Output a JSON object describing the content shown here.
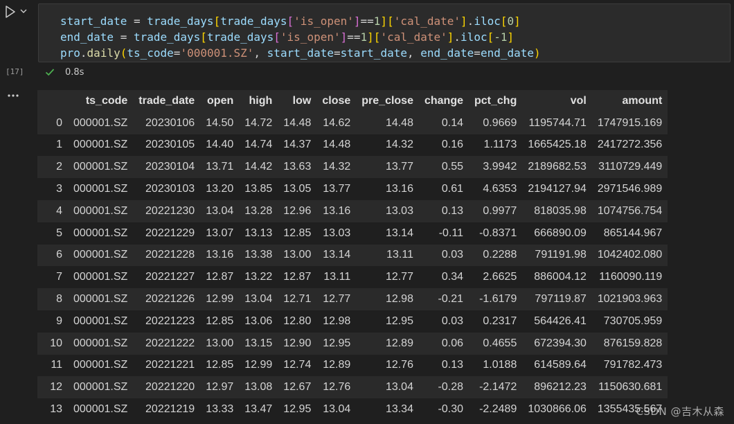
{
  "cell": {
    "execution_count": "[17]",
    "status_time": "0.8s",
    "code_lines": [
      [
        {
          "t": "start_date",
          "c": "v"
        },
        {
          "t": " = ",
          "c": "op"
        },
        {
          "t": "trade_days",
          "c": "v"
        },
        {
          "t": "[",
          "c": "b"
        },
        {
          "t": "trade_days",
          "c": "v"
        },
        {
          "t": "[",
          "c": "b2"
        },
        {
          "t": "'is_open'",
          "c": "s"
        },
        {
          "t": "]",
          "c": "b2"
        },
        {
          "t": "==",
          "c": "op"
        },
        {
          "t": "1",
          "c": "n"
        },
        {
          "t": "]",
          "c": "b"
        },
        {
          "t": "[",
          "c": "b"
        },
        {
          "t": "'cal_date'",
          "c": "s"
        },
        {
          "t": "]",
          "c": "b"
        },
        {
          "t": ".",
          "c": "op"
        },
        {
          "t": "iloc",
          "c": "v"
        },
        {
          "t": "[",
          "c": "b"
        },
        {
          "t": "0",
          "c": "n"
        },
        {
          "t": "]",
          "c": "b"
        }
      ],
      [
        {
          "t": "end_date",
          "c": "v"
        },
        {
          "t": " = ",
          "c": "op"
        },
        {
          "t": "trade_days",
          "c": "v"
        },
        {
          "t": "[",
          "c": "b"
        },
        {
          "t": "trade_days",
          "c": "v"
        },
        {
          "t": "[",
          "c": "b2"
        },
        {
          "t": "'is_open'",
          "c": "s"
        },
        {
          "t": "]",
          "c": "b2"
        },
        {
          "t": "==",
          "c": "op"
        },
        {
          "t": "1",
          "c": "n"
        },
        {
          "t": "]",
          "c": "b"
        },
        {
          "t": "[",
          "c": "b"
        },
        {
          "t": "'cal_date'",
          "c": "s"
        },
        {
          "t": "]",
          "c": "b"
        },
        {
          "t": ".",
          "c": "op"
        },
        {
          "t": "iloc",
          "c": "v"
        },
        {
          "t": "[",
          "c": "b"
        },
        {
          "t": "-1",
          "c": "n"
        },
        {
          "t": "]",
          "c": "b"
        }
      ],
      [
        {
          "t": "pro",
          "c": "v"
        },
        {
          "t": ".",
          "c": "op"
        },
        {
          "t": "daily",
          "c": "f"
        },
        {
          "t": "(",
          "c": "b"
        },
        {
          "t": "ts_code",
          "c": "v"
        },
        {
          "t": "=",
          "c": "op"
        },
        {
          "t": "'000001.SZ'",
          "c": "s"
        },
        {
          "t": ", ",
          "c": "op"
        },
        {
          "t": "start_date",
          "c": "v"
        },
        {
          "t": "=",
          "c": "op"
        },
        {
          "t": "start_date",
          "c": "v"
        },
        {
          "t": ", ",
          "c": "op"
        },
        {
          "t": "end_date",
          "c": "v"
        },
        {
          "t": "=",
          "c": "op"
        },
        {
          "t": "end_date",
          "c": "v"
        },
        {
          "t": ")",
          "c": "b"
        }
      ]
    ]
  },
  "table": {
    "columns": [
      "",
      "ts_code",
      "trade_date",
      "open",
      "high",
      "low",
      "close",
      "pre_close",
      "change",
      "pct_chg",
      "vol",
      "amount"
    ],
    "rows": [
      [
        "0",
        "000001.SZ",
        "20230106",
        "14.50",
        "14.72",
        "14.48",
        "14.62",
        "14.48",
        "0.14",
        "0.9669",
        "1195744.71",
        "1747915.169"
      ],
      [
        "1",
        "000001.SZ",
        "20230105",
        "14.40",
        "14.74",
        "14.37",
        "14.48",
        "14.32",
        "0.16",
        "1.1173",
        "1665425.18",
        "2417272.356"
      ],
      [
        "2",
        "000001.SZ",
        "20230104",
        "13.71",
        "14.42",
        "13.63",
        "14.32",
        "13.77",
        "0.55",
        "3.9942",
        "2189682.53",
        "3110729.449"
      ],
      [
        "3",
        "000001.SZ",
        "20230103",
        "13.20",
        "13.85",
        "13.05",
        "13.77",
        "13.16",
        "0.61",
        "4.6353",
        "2194127.94",
        "2971546.989"
      ],
      [
        "4",
        "000001.SZ",
        "20221230",
        "13.04",
        "13.28",
        "12.96",
        "13.16",
        "13.03",
        "0.13",
        "0.9977",
        "818035.98",
        "1074756.754"
      ],
      [
        "5",
        "000001.SZ",
        "20221229",
        "13.07",
        "13.13",
        "12.85",
        "13.03",
        "13.14",
        "-0.11",
        "-0.8371",
        "666890.09",
        "865144.967"
      ],
      [
        "6",
        "000001.SZ",
        "20221228",
        "13.16",
        "13.38",
        "13.00",
        "13.14",
        "13.11",
        "0.03",
        "0.2288",
        "791191.98",
        "1042402.080"
      ],
      [
        "7",
        "000001.SZ",
        "20221227",
        "12.87",
        "13.22",
        "12.87",
        "13.11",
        "12.77",
        "0.34",
        "2.6625",
        "886004.12",
        "1160090.119"
      ],
      [
        "8",
        "000001.SZ",
        "20221226",
        "12.99",
        "13.04",
        "12.71",
        "12.77",
        "12.98",
        "-0.21",
        "-1.6179",
        "797119.87",
        "1021903.963"
      ],
      [
        "9",
        "000001.SZ",
        "20221223",
        "12.85",
        "13.06",
        "12.80",
        "12.98",
        "12.95",
        "0.03",
        "0.2317",
        "564426.41",
        "730705.959"
      ],
      [
        "10",
        "000001.SZ",
        "20221222",
        "13.00",
        "13.15",
        "12.90",
        "12.95",
        "12.89",
        "0.06",
        "0.4655",
        "672394.30",
        "876159.828"
      ],
      [
        "11",
        "000001.SZ",
        "20221221",
        "12.85",
        "12.99",
        "12.74",
        "12.89",
        "12.76",
        "0.13",
        "1.0188",
        "614589.64",
        "791782.473"
      ],
      [
        "12",
        "000001.SZ",
        "20221220",
        "12.97",
        "13.08",
        "12.67",
        "12.76",
        "13.04",
        "-0.28",
        "-2.1472",
        "896212.23",
        "1150630.681"
      ],
      [
        "13",
        "000001.SZ",
        "20221219",
        "13.33",
        "13.47",
        "12.95",
        "13.04",
        "13.34",
        "-0.30",
        "-2.2489",
        "1030866.06",
        "1355435.567"
      ]
    ]
  },
  "watermark": "CSDN @吉木从森",
  "icons": {
    "run": "play-icon",
    "run_menu": "chevron-down-icon",
    "success": "check-icon",
    "output_menu": "ellipsis-icon"
  },
  "colors": {
    "background": "#1f1f1f",
    "editor_bg": "#2b2b2b",
    "success": "#4caf50",
    "string": "#ce9178",
    "variable": "#9cdcfe",
    "number": "#b5cea8"
  }
}
